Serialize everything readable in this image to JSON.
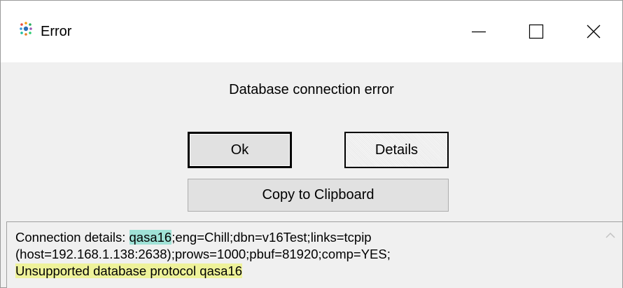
{
  "window": {
    "title": "Error",
    "icon": "app-logo-icon",
    "controls": [
      "minimize-icon",
      "maximize-icon",
      "close-icon"
    ]
  },
  "dialog": {
    "message": "Database connection error",
    "buttons": {
      "ok_label": "Ok",
      "details_label": "Details",
      "copy_label": "Copy to Clipboard"
    }
  },
  "details": {
    "prefix": "Connection details: ",
    "server": "qasa16",
    "line1_rest": ";eng=Chill;dbn=v16Test;links=tcpip",
    "line2": "(host=192.168.1.138:2638);prows=1000;pbuf=81920;comp=YES;",
    "error": "Unsupported database protocol qasa16"
  },
  "colors": {
    "highlight_server": "#9fe2d6",
    "highlight_error": "#eef29a"
  }
}
